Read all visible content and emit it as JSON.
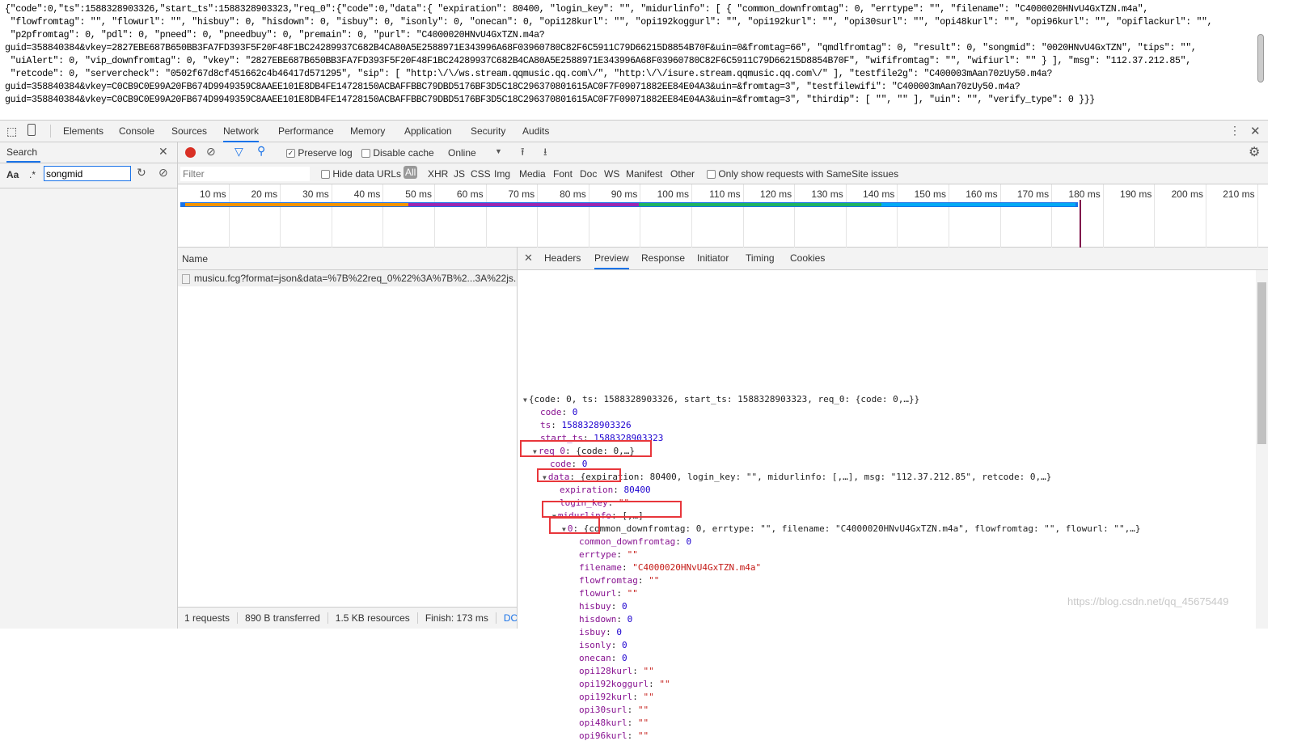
{
  "raw_response_lines": [
    "{\"code\":0,\"ts\":1588328903326,\"start_ts\":1588328903323,\"req_0\":{\"code\":0,\"data\":{ \"expiration\": 80400, \"login_key\": \"\", \"midurlinfo\": [ { \"common_downfromtag\": 0, \"errtype\": \"\", \"filename\": \"C4000020HNvU4GxTZN.m4a\",",
    " \"flowfromtag\": \"\", \"flowurl\": \"\", \"hisbuy\": 0, \"hisdown\": 0, \"isbuy\": 0, \"isonly\": 0, \"onecan\": 0, \"opi128kurl\": \"\", \"opi192koggurl\": \"\", \"opi192kurl\": \"\", \"opi30surl\": \"\", \"opi48kurl\": \"\", \"opi96kurl\": \"\", \"opiflackurl\": \"\",",
    " \"p2pfromtag\": 0, \"pdl\": 0, \"pneed\": 0, \"pneedbuy\": 0, \"premain\": 0, \"purl\": \"C4000020HNvU4GxTZN.m4a?",
    "guid=358840384&vkey=2827EBE687B650BB3FA7FD393F5F20F48F1BC24289937C682B4CA80A5E2588971E343996A68F03960780C82F6C5911C79D66215D8854B70F&uin=0&fromtag=66\", \"qmdlfromtag\": 0, \"result\": 0, \"songmid\": \"0020HNvU4GxTZN\", \"tips\": \"\",",
    " \"uiAlert\": 0, \"vip_downfromtag\": 0, \"vkey\": \"2827EBE687B650BB3FA7FD393F5F20F48F1BC24289937C682B4CA80A5E2588971E343996A68F03960780C82F6C5911C79D66215D8854B70F\", \"wififromtag\": \"\", \"wifiurl\": \"\" } ], \"msg\": \"112.37.212.85\",",
    " \"retcode\": 0, \"servercheck\": \"0502f67d8cf451662c4b46417d571295\", \"sip\": [ \"http:\\/\\/ws.stream.qqmusic.qq.com\\/\", \"http:\\/\\/isure.stream.qqmusic.qq.com\\/\" ], \"testfile2g\": \"C400003mAan70zUy50.m4a?",
    "guid=358840384&vkey=C0CB9C0E99A20FB674D9949359C8AAEE101E8DB4FE14728150ACBAFFBBC79DBD5176BF3D5C18C296370801615AC0F7F09071882EE84E04A3&uin=&fromtag=3\", \"testfilewifi\": \"C400003mAan70zUy50.m4a?",
    "guid=358840384&vkey=C0CB9C0E99A20FB674D9949359C8AAEE101E8DB4FE14728150ACBAFFBBC79DBD5176BF3D5C18C296370801615AC0F7F09071882EE84E04A3&uin=&fromtag=3\", \"thirdip\": [ \"\", \"\" ], \"uin\": \"\", \"verify_type\": 0 }}}"
  ],
  "devtools": {
    "tabs": [
      "Elements",
      "Console",
      "Sources",
      "Network",
      "Performance",
      "Memory",
      "Application",
      "Security",
      "Audits"
    ],
    "active_tab": "Network",
    "search": {
      "title": "Search",
      "case_label": "Aa",
      "regex_label": ".*",
      "query": "songmid"
    },
    "toolbar": {
      "preserve_log": "Preserve log",
      "preserve_log_checked": true,
      "disable_cache": "Disable cache",
      "throttle": "Online"
    },
    "filter": {
      "placeholder": "Filter",
      "hide_data_urls": "Hide data URLs",
      "types": [
        "All",
        "XHR",
        "JS",
        "CSS",
        "Img",
        "Media",
        "Font",
        "Doc",
        "WS",
        "Manifest",
        "Other"
      ],
      "samesite": "Only show requests with SameSite issues"
    },
    "timeline_ticks": [
      "10 ms",
      "20 ms",
      "30 ms",
      "40 ms",
      "50 ms",
      "60 ms",
      "70 ms",
      "80 ms",
      "90 ms",
      "100 ms",
      "110 ms",
      "120 ms",
      "130 ms",
      "140 ms",
      "150 ms",
      "160 ms",
      "170 ms",
      "180 ms",
      "190 ms",
      "200 ms",
      "210 ms"
    ],
    "list": {
      "header": "Name",
      "rows": [
        "musicu.fcg?format=json&data=%7B%22req_0%22%3A%7B%2...3A%22js..."
      ]
    },
    "status": [
      "1 requests",
      "890 B transferred",
      "1.5 KB resources",
      "Finish: 173 ms",
      "DOMC"
    ],
    "preview_tabs": [
      "Headers",
      "Preview",
      "Response",
      "Initiator",
      "Timing",
      "Cookies"
    ],
    "active_preview_tab": "Preview",
    "tree": [
      {
        "d": 0,
        "t": "tri",
        "text": "{code: 0, ts: 1588328903326, start_ts: 1588328903323, req_0: {code: 0,…}}"
      },
      {
        "d": 1,
        "k": "code",
        "v": "0",
        "c": "n"
      },
      {
        "d": 1,
        "k": "ts",
        "v": "1588328903326",
        "c": "n"
      },
      {
        "d": 1,
        "k": "start_ts",
        "v": "1588328903323",
        "c": "n"
      },
      {
        "d": 1,
        "t": "tri",
        "k": "req_0",
        "text": "{code: 0,…}"
      },
      {
        "d": 2,
        "k": "code",
        "v": "0",
        "c": "n"
      },
      {
        "d": 2,
        "t": "tri",
        "k": "data",
        "text": "{expiration: 80400, login_key: \"\", midurlinfo: [,…], msg: \"112.37.212.85\", retcode: 0,…}"
      },
      {
        "d": 3,
        "k": "expiration",
        "v": "80400",
        "c": "n"
      },
      {
        "d": 3,
        "k": "login_key",
        "v": "\"\"",
        "c": "s"
      },
      {
        "d": 3,
        "t": "tri",
        "k": "midurlinfo",
        "text": "[,…]"
      },
      {
        "d": 4,
        "t": "tri",
        "k": "0",
        "text": "{common_downfromtag: 0, errtype: \"\", filename: \"C4000020HNvU4GxTZN.m4a\", flowfromtag: \"\", flowurl: \"\",…}"
      },
      {
        "d": 5,
        "k": "common_downfromtag",
        "v": "0",
        "c": "n"
      },
      {
        "d": 5,
        "k": "errtype",
        "v": "\"\"",
        "c": "s"
      },
      {
        "d": 5,
        "k": "filename",
        "v": "\"C4000020HNvU4GxTZN.m4a\"",
        "c": "s"
      },
      {
        "d": 5,
        "k": "flowfromtag",
        "v": "\"\"",
        "c": "s"
      },
      {
        "d": 5,
        "k": "flowurl",
        "v": "\"\"",
        "c": "s"
      },
      {
        "d": 5,
        "k": "hisbuy",
        "v": "0",
        "c": "n"
      },
      {
        "d": 5,
        "k": "hisdown",
        "v": "0",
        "c": "n"
      },
      {
        "d": 5,
        "k": "isbuy",
        "v": "0",
        "c": "n"
      },
      {
        "d": 5,
        "k": "isonly",
        "v": "0",
        "c": "n"
      },
      {
        "d": 5,
        "k": "onecan",
        "v": "0",
        "c": "n"
      },
      {
        "d": 5,
        "k": "opi128kurl",
        "v": "\"\"",
        "c": "s"
      },
      {
        "d": 5,
        "k": "opi192koggurl",
        "v": "\"\"",
        "c": "s"
      },
      {
        "d": 5,
        "k": "opi192kurl",
        "v": "\"\"",
        "c": "s"
      },
      {
        "d": 5,
        "k": "opi30surl",
        "v": "\"\"",
        "c": "s"
      },
      {
        "d": 5,
        "k": "opi48kurl",
        "v": "\"\"",
        "c": "s"
      },
      {
        "d": 5,
        "k": "opi96kurl",
        "v": "\"\"",
        "c": "s"
      }
    ]
  },
  "watermark": "https://blog.csdn.net/qq_45675449",
  "colors": {
    "accent": "#1a73e8",
    "record": "#d93025",
    "highlight_box": "#e8363b",
    "key": "#881391",
    "number": "#1c00cf",
    "string": "#c41a16"
  }
}
